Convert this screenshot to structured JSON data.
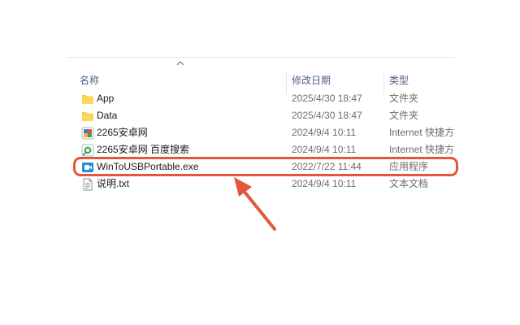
{
  "columns": {
    "name": "名称",
    "date": "修改日期",
    "type": "类型"
  },
  "files": [
    {
      "icon": "folder-icon",
      "name": "App",
      "date": "2025/4/30 18:47",
      "type": "文件夹"
    },
    {
      "icon": "folder-icon",
      "name": "Data",
      "date": "2025/4/30 18:47",
      "type": "文件夹"
    },
    {
      "icon": "internet-shortcut-icon",
      "name": "2265安卓网",
      "date": "2024/9/4 10:11",
      "type": "Internet 快捷方式"
    },
    {
      "icon": "internet-shortcut-icon",
      "name": "2265安卓网 百度搜索",
      "date": "2024/9/4 10:11",
      "type": "Internet 快捷方式"
    },
    {
      "icon": "application-icon",
      "name": "WinToUSBPortable.exe",
      "date": "2022/7/22 11:44",
      "type": "应用程序"
    },
    {
      "icon": "text-file-icon",
      "name": "说明.txt",
      "date": "2024/9/4 10:11",
      "type": "文本文档"
    }
  ],
  "highlight_color": "#e2573d",
  "folder_color": "#f8cc4a",
  "header_text_color": "#4d6082"
}
